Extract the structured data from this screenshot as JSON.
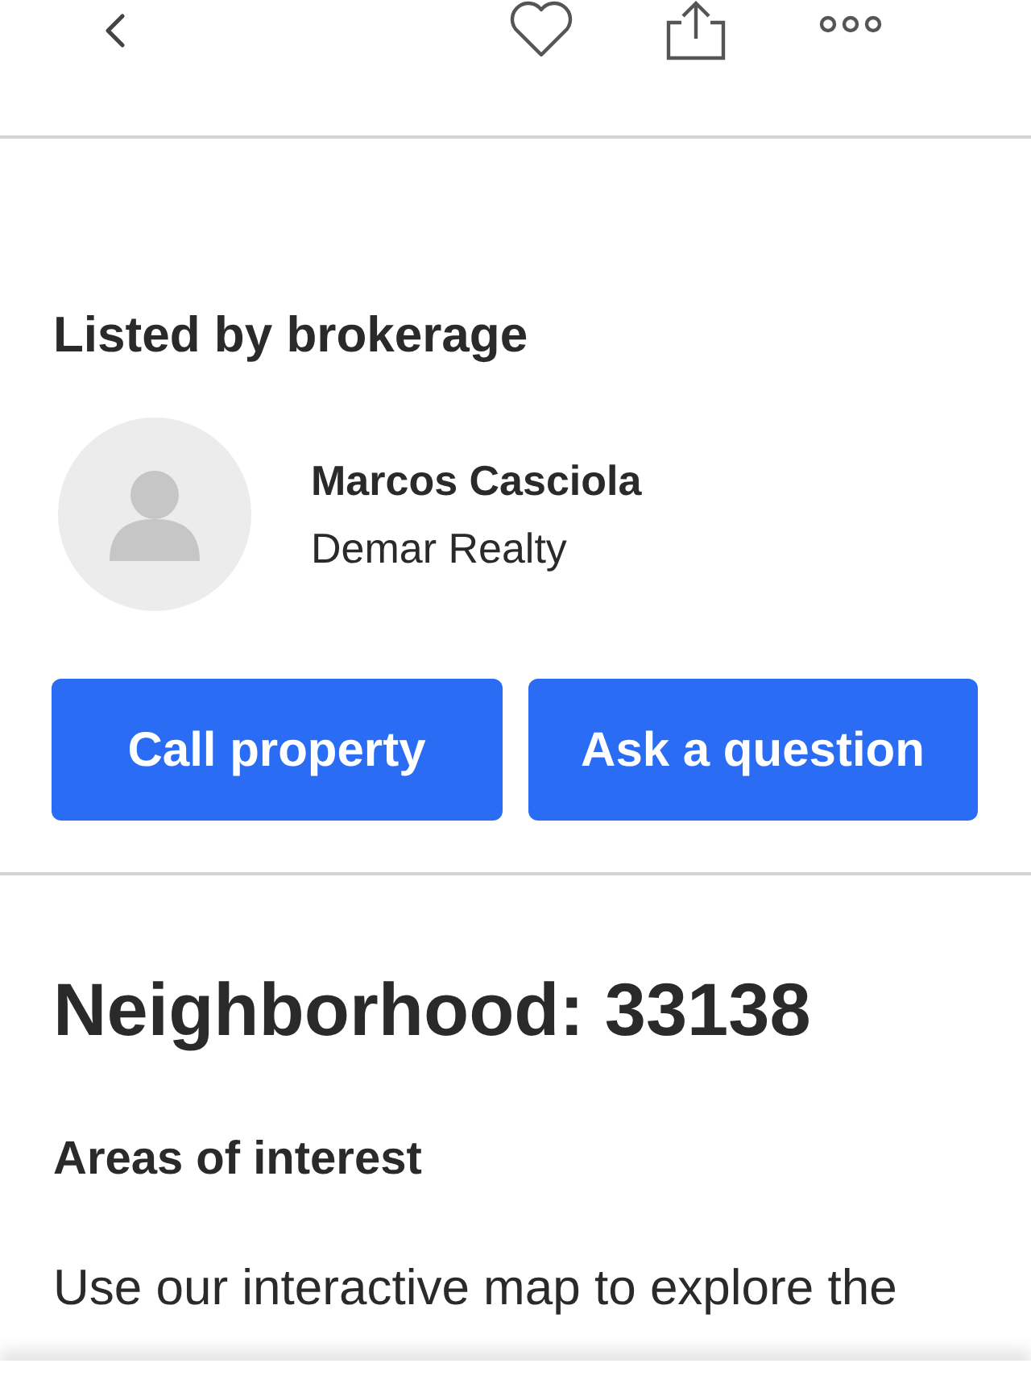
{
  "header": {
    "actions": [
      {
        "kind": "back"
      },
      {
        "kind": "favorite"
      },
      {
        "kind": "share"
      },
      {
        "kind": "more"
      }
    ]
  },
  "listing": {
    "title": "Listed by brokerage",
    "agent": {
      "name": "Marcos Casciola",
      "company": "Demar Realty"
    },
    "buttons": [
      "Call property",
      "Ask a question"
    ]
  },
  "neighborhood": {
    "title": "Neighborhood: 33138",
    "subtitle": "Areas of interest",
    "text": "Use our interactive map to explore the"
  }
}
